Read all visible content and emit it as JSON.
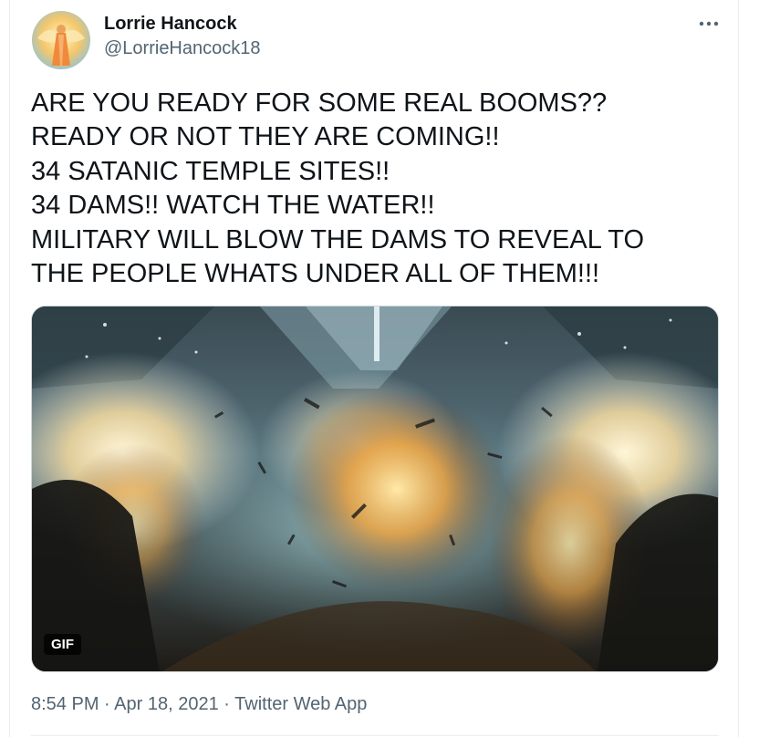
{
  "tweet": {
    "author_name": "Lorrie Hancock",
    "author_handle": "@LorrieHancock18",
    "text": "ARE YOU READY FOR SOME REAL BOOMS??\nREADY OR NOT THEY ARE COMING!!\n34 SATANIC TEMPLE SITES!!\n34 DAMS!! WATCH THE WATER!!\nMILITARY WILL BLOW THE DAMS TO REVEAL TO\nTHE PEOPLE WHATS UNDER ALL OF THEM!!!",
    "media_badge": "GIF",
    "time": "8:54 PM",
    "separator": "·",
    "date": "Apr 18, 2021",
    "source": "Twitter Web App"
  },
  "icons": {
    "more": "more-horizontal-icon"
  },
  "colors": {
    "primary_text": "#0f1419",
    "secondary_text": "#536471",
    "border": "#ebeef0"
  }
}
